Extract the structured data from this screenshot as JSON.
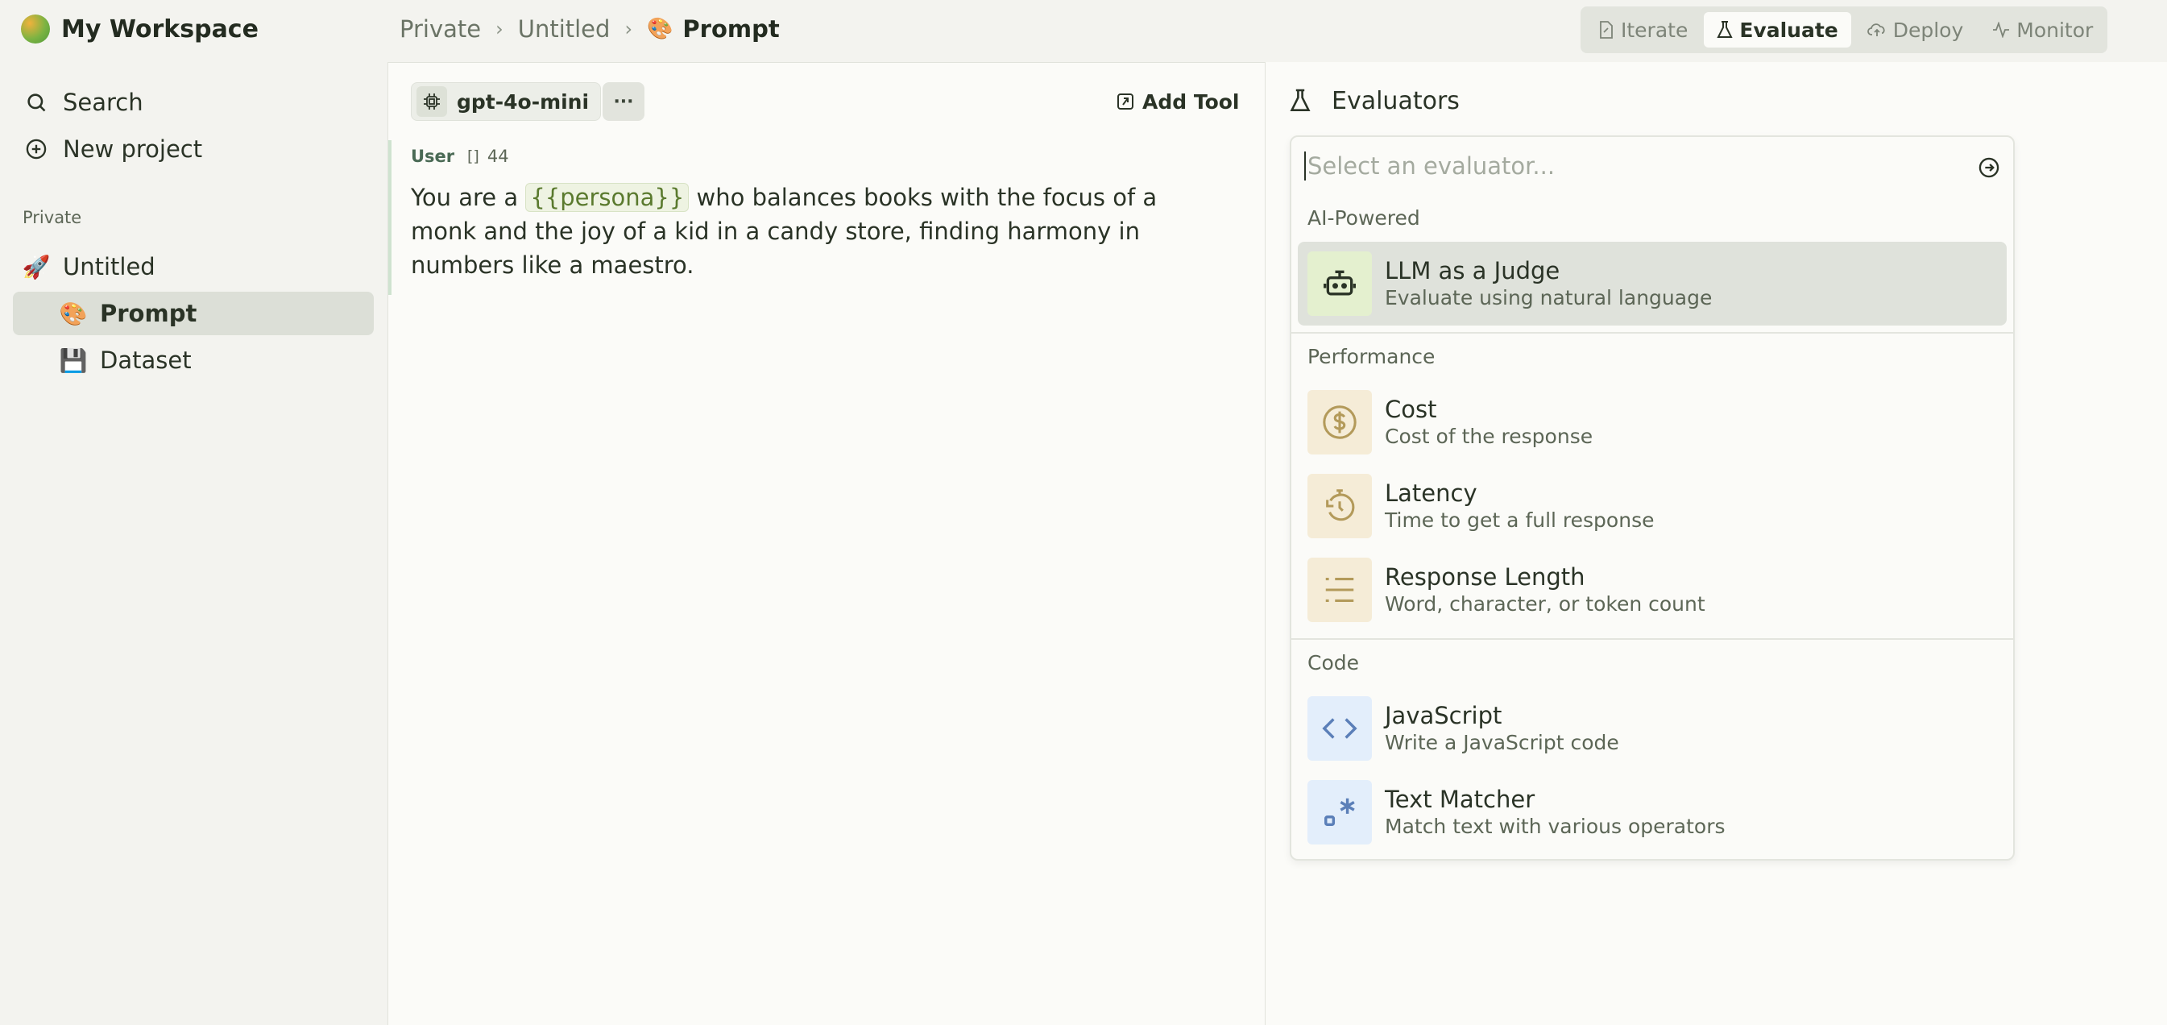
{
  "workspace": {
    "name": "My Workspace"
  },
  "sidebar": {
    "search_label": "Search",
    "new_project_label": "New project",
    "section_label": "Private",
    "items": [
      {
        "label": "Untitled",
        "icon": "rocket-icon"
      },
      {
        "label": "Prompt",
        "icon": "palette-icon",
        "active": true
      },
      {
        "label": "Dataset",
        "icon": "floppy-disk-icon"
      }
    ]
  },
  "breadcrumb": {
    "items": [
      "Private",
      "Untitled"
    ],
    "current": "Prompt"
  },
  "modes": {
    "iterate": "Iterate",
    "evaluate": "Evaluate",
    "deploy": "Deploy",
    "monitor": "Monitor",
    "active": "Evaluate"
  },
  "editor": {
    "model": "gpt-4o-mini",
    "more_label": "···",
    "add_tool_label": "Add Tool",
    "message": {
      "role": "User",
      "token_count": "44",
      "text_before": "You are a ",
      "variable": "{{persona}}",
      "text_after": " who balances books with the focus of a monk and the joy of a kid in a candy store, finding harmony in numbers like a maestro."
    }
  },
  "evaluators": {
    "title": "Evaluators",
    "search_placeholder": "Select an evaluator...",
    "groups": [
      {
        "label": "AI-Powered",
        "options": [
          {
            "title": "LLM as a Judge",
            "desc": "Evaluate using natural language",
            "icon": "robot-icon"
          }
        ]
      },
      {
        "label": "Performance",
        "options": [
          {
            "title": "Cost",
            "desc": "Cost of the response",
            "icon": "dollar-icon"
          },
          {
            "title": "Latency",
            "desc": "Time to get a full response",
            "icon": "timer-icon"
          },
          {
            "title": "Response Length",
            "desc": "Word, character, or token count",
            "icon": "list-icon"
          }
        ]
      },
      {
        "label": "Code",
        "options": [
          {
            "title": "JavaScript",
            "desc": "Write a JavaScript code",
            "icon": "code-icon"
          },
          {
            "title": "Text Matcher",
            "desc": "Match text with various operators",
            "icon": "regex-icon"
          }
        ]
      }
    ]
  },
  "colors": {
    "accent_green": "#e4f0cf",
    "performance_tan": "#f5ecd7",
    "code_blue": "#e3eefb",
    "active_bg": "#dfe2db"
  }
}
